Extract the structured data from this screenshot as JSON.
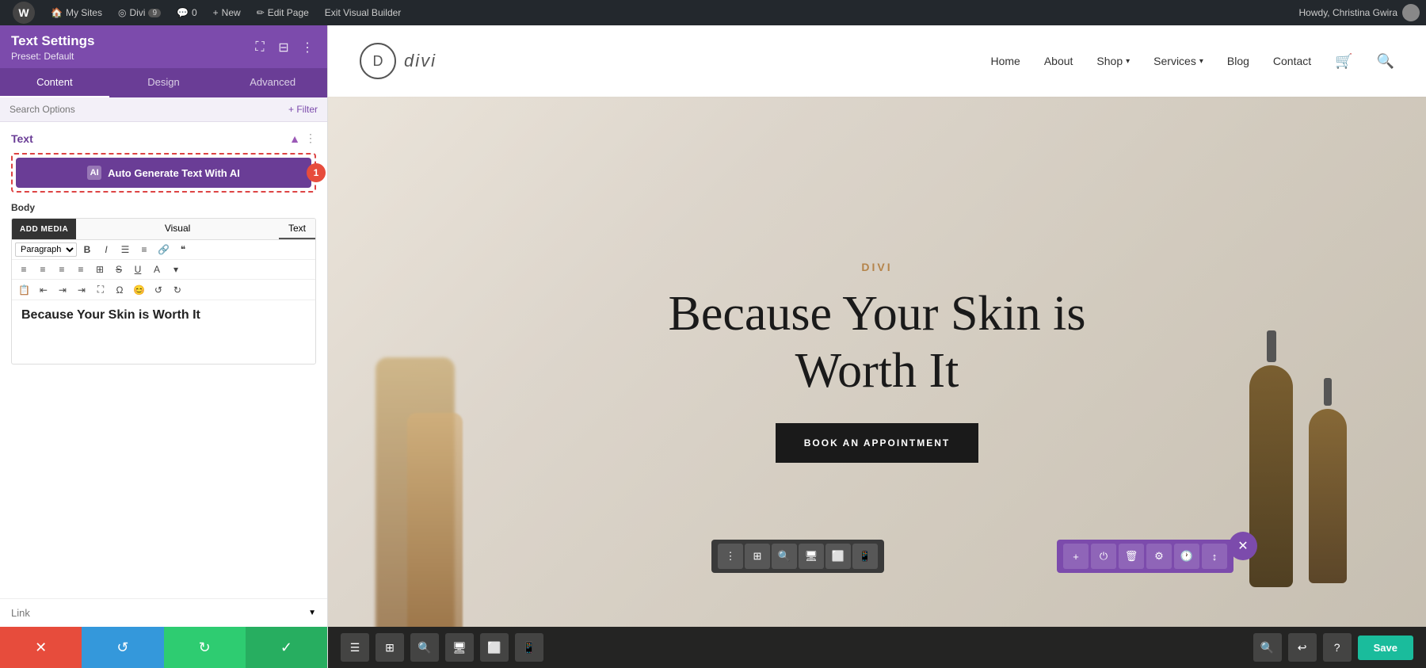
{
  "admin_bar": {
    "wp_icon": "W",
    "my_sites": "My Sites",
    "divi": "Divi",
    "comments_count": "9",
    "comments_bubble": "0",
    "new_label": "New",
    "edit_page": "Edit Page",
    "exit_builder": "Exit Visual Builder",
    "howdy": "Howdy, Christina Gwira"
  },
  "left_panel": {
    "title": "Text Settings",
    "preset": "Preset: Default",
    "tabs": [
      "Content",
      "Design",
      "Advanced"
    ],
    "active_tab": "Content",
    "search_placeholder": "Search Options",
    "filter_label": "+ Filter",
    "section_text": "Text",
    "ai_button_label": "Auto Generate Text With AI",
    "ai_badge": "1",
    "body_label": "Body",
    "add_media": "ADD MEDIA",
    "visual_tab": "Visual",
    "text_tab": "Text",
    "paragraph_select": "Paragraph",
    "editor_content": "Because Your Skin is Worth It",
    "link_label": "Link",
    "bottom_buttons": {
      "cancel": "✕",
      "reset": "↺",
      "redo": "↻",
      "confirm": "✓"
    }
  },
  "site": {
    "logo_d": "D",
    "logo_name": "divi",
    "nav_links": [
      "Home",
      "About",
      "Shop",
      "Services",
      "Blog",
      "Contact"
    ],
    "hero_label": "DIVI",
    "hero_title": "Because Your Skin is Worth It",
    "cta_button": "BOOK AN APPOINTMENT"
  },
  "builder": {
    "save_label": "Save",
    "tools": [
      "☰",
      "⊞",
      "🔍",
      "🖥",
      "⬜",
      "📱"
    ]
  }
}
